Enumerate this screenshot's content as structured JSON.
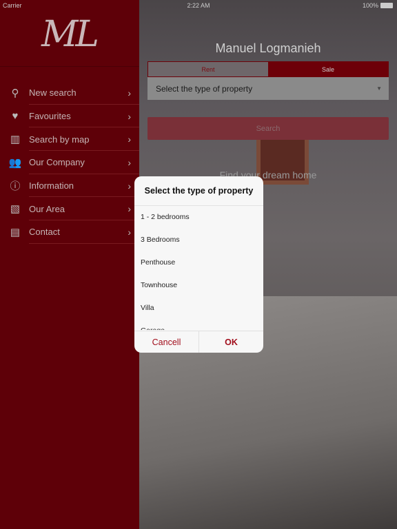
{
  "status": {
    "carrier": "Carrier",
    "time": "2:22 AM",
    "battery": "100%"
  },
  "logo": "ML",
  "sidebar": {
    "items": [
      {
        "label": "New search",
        "icon": "search-icon",
        "glyph": "⚲"
      },
      {
        "label": "Favourites",
        "icon": "heart-icon",
        "glyph": "♥"
      },
      {
        "label": "Search by map",
        "icon": "map-icon",
        "glyph": "▥"
      },
      {
        "label": "Our Company",
        "icon": "people-icon",
        "glyph": "👥"
      },
      {
        "label": "Information",
        "icon": "info-icon",
        "glyph": "ⓘ"
      },
      {
        "label": "Our Area",
        "icon": "photos-icon",
        "glyph": "▧"
      },
      {
        "label": "Contact",
        "icon": "chat-icon",
        "glyph": "▤"
      }
    ]
  },
  "main": {
    "title": "Manuel Logmanieh",
    "tabs": [
      "Rent",
      "Sale"
    ],
    "select_placeholder": "Select the type of property",
    "search_label": "Search",
    "tagline": "Find your dream home"
  },
  "dialog": {
    "title": "Select the type of property",
    "options": [
      "1 - 2 bedrooms",
      "3 Bedrooms",
      "Penthouse",
      "Townhouse",
      "Villa",
      "Garage"
    ],
    "cancel": "Cancell",
    "ok": "OK"
  },
  "colors": {
    "brand": "#5e0008",
    "accent": "#a10d1b"
  }
}
